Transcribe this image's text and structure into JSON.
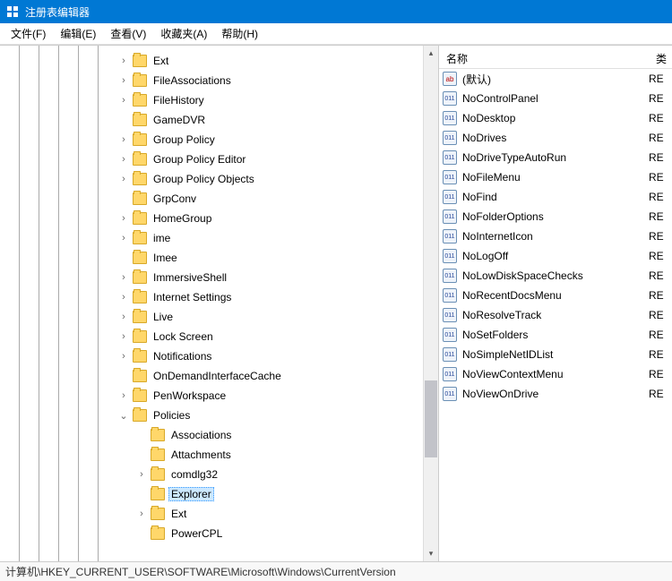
{
  "window": {
    "title": "注册表编辑器"
  },
  "menubar": {
    "file": "文件(F)",
    "edit": "编辑(E)",
    "view": "查看(V)",
    "favorites": "收藏夹(A)",
    "help": "帮助(H)"
  },
  "tree": {
    "items": [
      {
        "label": "Ext",
        "expandable": true
      },
      {
        "label": "FileAssociations",
        "expandable": true
      },
      {
        "label": "FileHistory",
        "expandable": true
      },
      {
        "label": "GameDVR",
        "expandable": false
      },
      {
        "label": "Group Policy",
        "expandable": true
      },
      {
        "label": "Group Policy Editor",
        "expandable": true
      },
      {
        "label": "Group Policy Objects",
        "expandable": true
      },
      {
        "label": "GrpConv",
        "expandable": false
      },
      {
        "label": "HomeGroup",
        "expandable": true
      },
      {
        "label": "ime",
        "expandable": true
      },
      {
        "label": "Imee",
        "expandable": false
      },
      {
        "label": "ImmersiveShell",
        "expandable": true
      },
      {
        "label": "Internet Settings",
        "expandable": true
      },
      {
        "label": "Live",
        "expandable": true
      },
      {
        "label": "Lock Screen",
        "expandable": true
      },
      {
        "label": "Notifications",
        "expandable": true
      },
      {
        "label": "OnDemandInterfaceCache",
        "expandable": false
      },
      {
        "label": "PenWorkspace",
        "expandable": true
      },
      {
        "label": "Policies",
        "expandable": true,
        "expanded": true,
        "children": [
          {
            "label": "Associations",
            "expandable": false
          },
          {
            "label": "Attachments",
            "expandable": false
          },
          {
            "label": "comdlg32",
            "expandable": true
          },
          {
            "label": "Explorer",
            "expandable": false,
            "selected": true
          },
          {
            "label": "Ext",
            "expandable": true
          },
          {
            "label": "PowerCPL",
            "expandable": false
          }
        ]
      }
    ]
  },
  "values": {
    "header_name": "名称",
    "header_type": "类",
    "rows": [
      {
        "name": "(默认)",
        "type": "RE",
        "icon": "sz"
      },
      {
        "name": "NoControlPanel",
        "type": "RE",
        "icon": "bin"
      },
      {
        "name": "NoDesktop",
        "type": "RE",
        "icon": "bin"
      },
      {
        "name": "NoDrives",
        "type": "RE",
        "icon": "bin"
      },
      {
        "name": "NoDriveTypeAutoRun",
        "type": "RE",
        "icon": "bin"
      },
      {
        "name": "NoFileMenu",
        "type": "RE",
        "icon": "bin"
      },
      {
        "name": "NoFind",
        "type": "RE",
        "icon": "bin"
      },
      {
        "name": "NoFolderOptions",
        "type": "RE",
        "icon": "bin"
      },
      {
        "name": "NoInternetIcon",
        "type": "RE",
        "icon": "bin"
      },
      {
        "name": "NoLogOff",
        "type": "RE",
        "icon": "bin"
      },
      {
        "name": "NoLowDiskSpaceChecks",
        "type": "RE",
        "icon": "bin"
      },
      {
        "name": "NoRecentDocsMenu",
        "type": "RE",
        "icon": "bin"
      },
      {
        "name": "NoResolveTrack",
        "type": "RE",
        "icon": "bin"
      },
      {
        "name": "NoSetFolders",
        "type": "RE",
        "icon": "bin"
      },
      {
        "name": "NoSimpleNetIDList",
        "type": "RE",
        "icon": "bin"
      },
      {
        "name": "NoViewContextMenu",
        "type": "RE",
        "icon": "bin"
      },
      {
        "name": "NoViewOnDrive",
        "type": "RE",
        "icon": "bin"
      }
    ]
  },
  "statusbar": {
    "path": "计算机\\HKEY_CURRENT_USER\\SOFTWARE\\Microsoft\\Windows\\CurrentVersion"
  }
}
